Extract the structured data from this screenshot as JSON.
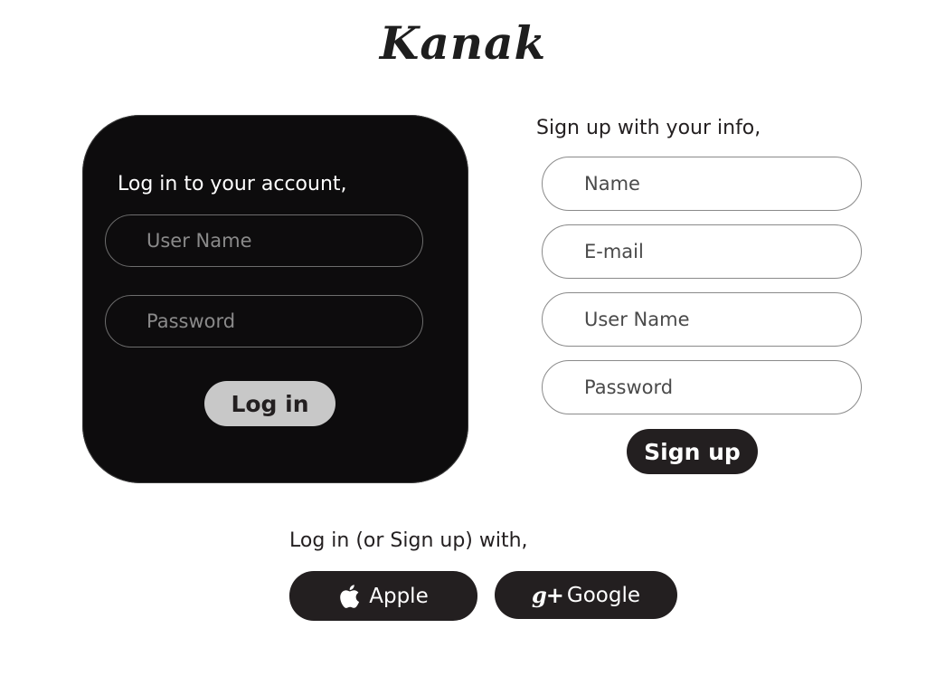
{
  "brand": {
    "logo_text": "Kanak"
  },
  "login": {
    "heading": "Log in to your account,",
    "username_placeholder": "User Name",
    "password_placeholder": "Password",
    "button_label": "Log in"
  },
  "signup": {
    "heading": "Sign up with your info,",
    "name_placeholder": "Name",
    "email_placeholder": "E-mail",
    "username_placeholder": "User Name",
    "password_placeholder": "Password",
    "button_label": "Sign up"
  },
  "social": {
    "heading": "Log in (or Sign up) with,",
    "apple": {
      "icon": "apple-icon",
      "label": "Apple"
    },
    "google": {
      "icon": "google-plus-icon",
      "icon_text": "g+",
      "label": "Google"
    }
  },
  "colors": {
    "dark_card": "#0d0c0d",
    "button_dark": "#231f20",
    "button_light": "#c8c8c8",
    "text": "#231f20"
  }
}
